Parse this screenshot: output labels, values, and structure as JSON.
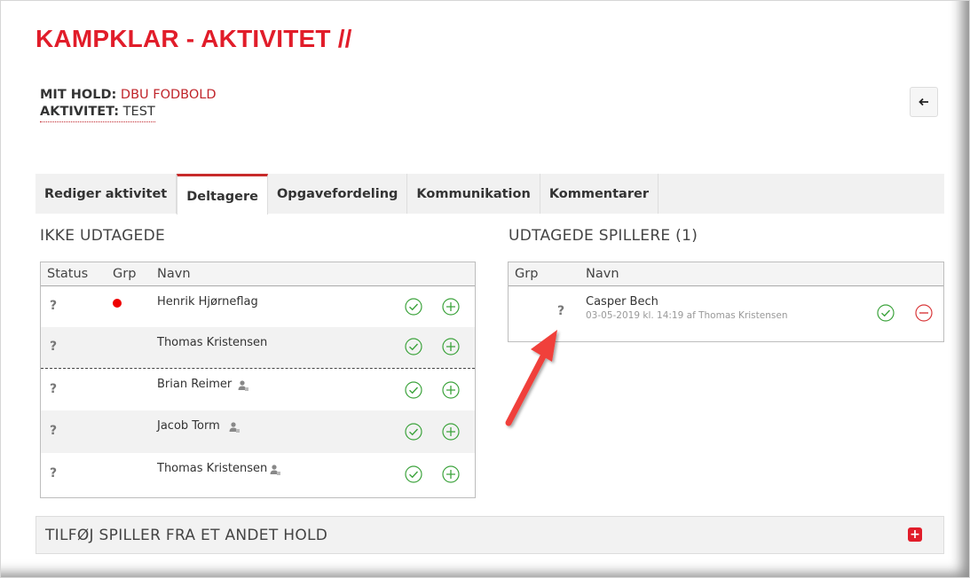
{
  "page": {
    "title": "KAMPKLAR - AKTIVITET //"
  },
  "info": {
    "team_label": "MIT HOLD:",
    "team_value": "DBU FODBOLD",
    "activity_label": "AKTIVITET:",
    "activity_value": "TEST"
  },
  "back_button": {
    "icon": "arrow-left-icon",
    "glyph": "🡐"
  },
  "tabs": [
    {
      "label": "Rediger aktivitet",
      "active": false
    },
    {
      "label": "Deltagere",
      "active": true
    },
    {
      "label": "Opgavefordeling",
      "active": false
    },
    {
      "label": "Kommunikation",
      "active": false
    },
    {
      "label": "Kommentarer",
      "active": false
    }
  ],
  "not_selected": {
    "title": "IKKE UDTAGEDE",
    "columns": {
      "status": "Status",
      "grp": "Grp",
      "name": "Navn"
    },
    "rows": [
      {
        "status": "?",
        "name": "Henrik Hjørneflag",
        "red_dot": true,
        "person_icon": false
      },
      {
        "status": "?",
        "name": "Thomas Kristensen",
        "red_dot": false,
        "person_icon": false
      },
      {
        "status": "?",
        "name": "Brian Reimer",
        "red_dot": false,
        "person_icon": true
      },
      {
        "status": "?",
        "name": "Jacob Torm",
        "red_dot": false,
        "person_icon": true
      },
      {
        "status": "?",
        "name": "Thomas Kristensen",
        "red_dot": false,
        "person_icon": true
      }
    ]
  },
  "selected": {
    "title": "UDTAGEDE SPILLERE (1)",
    "columns": {
      "grp": "Grp",
      "name": "Navn"
    },
    "rows": [
      {
        "status": "?",
        "name": "Casper Bech",
        "sub": "03-05-2019 kl. 14:19 af Thomas Kristensen"
      }
    ]
  },
  "add_bar": {
    "label": "TILFØJ SPILLER FRA ET ANDET HOLD",
    "plus": "+"
  },
  "colors": {
    "brand_red": "#e11d2a",
    "check_green": "#3ca33c",
    "remove_red": "#d9383a"
  }
}
